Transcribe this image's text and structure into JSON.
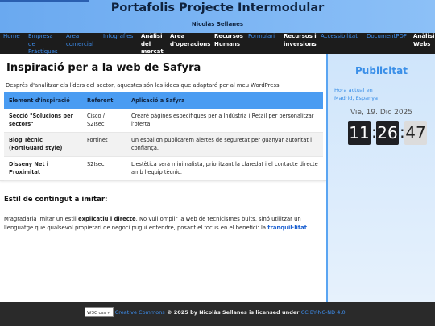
{
  "header": {
    "title": "Portafolis Projecte Intermodular",
    "author": "Nicolàs Sellanes"
  },
  "nav": {
    "home": "Home",
    "empresa": "Empresa de Pràctiques",
    "area": "Àrea comercial",
    "infografies": "Infografies",
    "analisi_mercat": "Anàlisi del mercat",
    "area_operacions": "Àrea d'operacions",
    "recursos_humans": "Recursos Humans",
    "formulari": "Formulari",
    "recursos_inversions": "Recursos i inversions",
    "accessibilitat": "Accessibilitat",
    "document": "DocumentPDF",
    "analisi_webs": "Anàlisi Webs"
  },
  "main": {
    "title": "Inspiració per a la web de Safyra",
    "intro": "Després d'analitzar els líders del sector, aquestes són les idees que adaptaré per al meu WordPress:",
    "table": {
      "headers": [
        "Element d'inspiració",
        "Referent",
        "Aplicació a Safyra"
      ],
      "rows": [
        [
          "Secció \"Solucions per sectors\"",
          "Cisco / S2Isec",
          "Crearé pàgines específiques per a Indústria i Retail per personalitzar l'oferta."
        ],
        [
          "Blog Tècnic (FortiGuard style)",
          "Fortinet",
          "Un espai on publicarem alertes de seguretat per guanyar autoritat i confiança."
        ],
        [
          "Disseny Net i Proximitat",
          "S2Isec",
          "L'estètica serà minimalista, prioritzant la claredat i el contacte directe amb l'equip tècnic."
        ]
      ]
    },
    "subtitle": "Estil de contingut a imitar:",
    "para_start": "M'agradaria imitar un estil ",
    "para_bold": "explicatiu i directe",
    "para_mid": ". No vull omplir la web de tecnicismes buits, sinó utilitzar un llenguatge que qualsevol propietari de negoci pugui entendre, posant el focus en el benefici: la ",
    "para_link": "tranquil·litat",
    "para_end": "."
  },
  "sidebar": {
    "title": "Publicitat",
    "tz_line1": "Hora actual en",
    "tz_line2": "Madrid, Espanya",
    "date": "Vie, 19. Dic 2025",
    "hours": "11",
    "minutes": "26",
    "seconds": "47"
  },
  "footer": {
    "badge": "W3C css ✓",
    "cc": "Creative Commons",
    "middle": " © 2025 by Nicolàs Sellanes is licensed under ",
    "license": "CC BY-NC-ND 4.0"
  },
  "colors": {
    "accent": "#3d8ff0",
    "table_header": "#4a9cf2",
    "nav_bg": "#1c1c1c",
    "footer_bg": "#2a2a2a"
  }
}
